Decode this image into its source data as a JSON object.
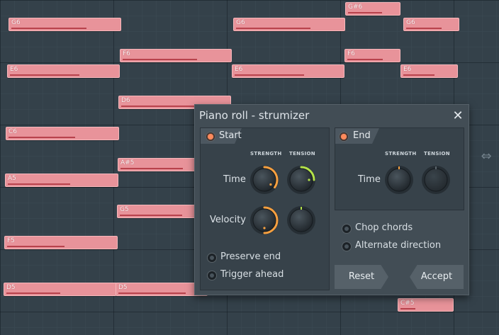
{
  "notes": [
    {
      "pitch": "G#6",
      "velocity": 0.68
    },
    {
      "pitch": "G6",
      "velocity": 0.7
    },
    {
      "pitch": "G6",
      "velocity": 0.7
    },
    {
      "pitch": "G6",
      "velocity": 0.7
    },
    {
      "pitch": "F6",
      "velocity": 0.7
    },
    {
      "pitch": "F6",
      "velocity": 0.7
    },
    {
      "pitch": "E6",
      "velocity": 0.65
    },
    {
      "pitch": "E6",
      "velocity": 0.65
    },
    {
      "pitch": "E6",
      "velocity": 0.6
    },
    {
      "pitch": "D6",
      "velocity": 0.68
    },
    {
      "pitch": "C6",
      "velocity": 0.62
    },
    {
      "pitch": "A#5",
      "velocity": 0.72
    },
    {
      "pitch": "A5",
      "velocity": 0.58
    },
    {
      "pitch": "G5",
      "velocity": 0.72
    },
    {
      "pitch": "F5",
      "velocity": 0.53
    },
    {
      "pitch": "D5",
      "velocity": 0.5
    },
    {
      "pitch": "D5",
      "velocity": 0.78
    },
    {
      "pitch": "C#5",
      "velocity": 0.3
    }
  ],
  "dialog": {
    "title": "Piano roll - strumizer",
    "close_icon": "close-icon",
    "start": {
      "label": "Start",
      "enabled": true,
      "strength_header": "STRENGTH",
      "tension_header": "TENSION",
      "time_label": "Time",
      "velocity_label": "Velocity",
      "knobs": {
        "time_strength": {
          "value": 0.35,
          "color": "#f7a040"
        },
        "time_tension": {
          "value": 0.25,
          "color": "#b4e24a"
        },
        "velocity_strength": {
          "value": 0.5,
          "color": "#f7a040"
        },
        "velocity_tension": {
          "value": 0.0,
          "color": "#b4e24a"
        }
      }
    },
    "end": {
      "label": "End",
      "enabled": true,
      "strength_header": "STRENGTH",
      "tension_header": "TENSION",
      "time_label": "Time",
      "knobs": {
        "time_strength": {
          "value": 0.0,
          "color": "#f7a040"
        },
        "time_tension": {
          "value": 0.0,
          "color": "#b4e24a",
          "disabled": true
        }
      }
    },
    "options": {
      "preserve_end": "Preserve end",
      "trigger_ahead": "Trigger ahead",
      "chop_chords": "Chop chords",
      "alternate_direction": "Alternate direction"
    },
    "buttons": {
      "reset": "Reset",
      "accept": "Accept"
    }
  },
  "colors": {
    "note_fill": "#e8939a",
    "note_velocity": "#b8424c",
    "dialog_bg": "#424d55",
    "accent": "#ff8a5c"
  }
}
